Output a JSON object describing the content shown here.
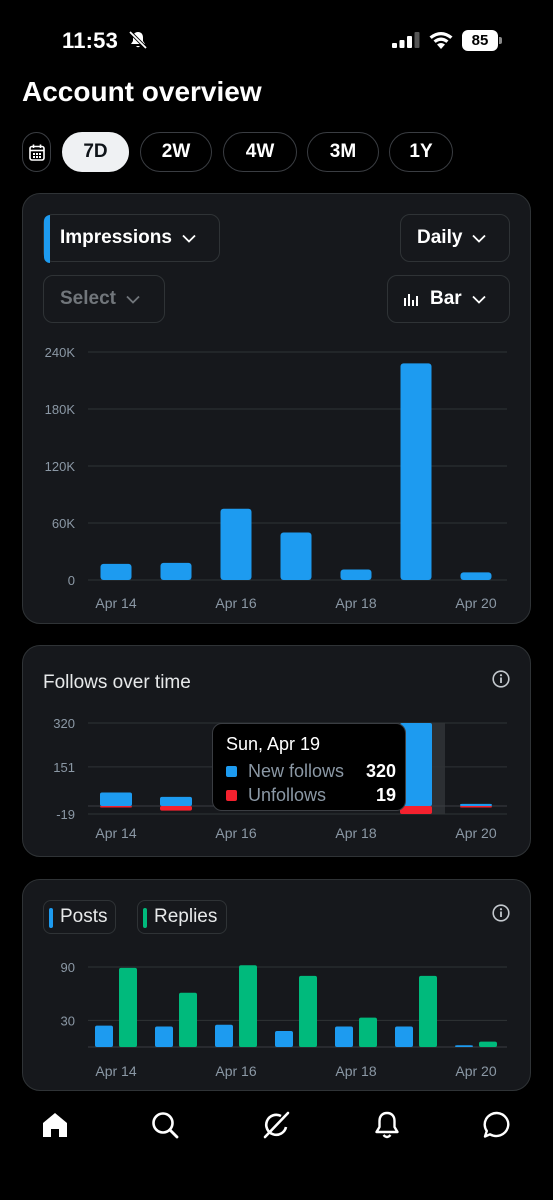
{
  "status_bar": {
    "time": "11:53",
    "battery": "85"
  },
  "page_title": "Account overview",
  "ranges": [
    {
      "label": "7D",
      "active": true
    },
    {
      "label": "2W",
      "active": false
    },
    {
      "label": "4W",
      "active": false
    },
    {
      "label": "3M",
      "active": false
    },
    {
      "label": "1Y",
      "active": false
    }
  ],
  "impressions_card": {
    "metric_select": "Impressions",
    "period_select": "Daily",
    "compare_select": "Select",
    "chart_type_select": "Bar"
  },
  "follows_card": {
    "title": "Follows over time",
    "tooltip": {
      "title": "Sun, Apr 19",
      "rows": [
        {
          "label": "New follows",
          "value": "320",
          "color": "#1d9bf0"
        },
        {
          "label": "Unfollows",
          "value": "19",
          "color": "#f4212e"
        }
      ]
    }
  },
  "posts_card": {
    "legend": [
      {
        "label": "Posts",
        "color": "#1d9bf0"
      },
      {
        "label": "Replies",
        "color": "#00ba7c"
      }
    ]
  },
  "bottom_nav": [
    "home-icon",
    "search-icon",
    "grok-icon",
    "notifications-icon",
    "messages-icon"
  ],
  "chart_data": [
    {
      "type": "bar",
      "categories": [
        "Apr 14",
        "Apr 15",
        "Apr 16",
        "Apr 17",
        "Apr 18",
        "Apr 19",
        "Apr 20"
      ],
      "x_tick_labels": [
        "Apr 14",
        "Apr 16",
        "Apr 18",
        "Apr 20"
      ],
      "series": [
        {
          "values": [
            17000,
            18000,
            75000,
            50000,
            11000,
            228000,
            8000
          ],
          "color": "#1d9bf0"
        }
      ],
      "y_ticks": [
        "240K",
        "180K",
        "120K",
        "60K",
        "0"
      ],
      "y_tick_values": [
        240000,
        180000,
        120000,
        60000,
        0
      ],
      "ylim": [
        0,
        240000
      ],
      "grid": true
    },
    {
      "type": "bar",
      "title": "Follows over time",
      "categories": [
        "Apr 14",
        "Apr 15",
        "Apr 16",
        "Apr 17",
        "Apr 18",
        "Apr 19",
        "Apr 20"
      ],
      "x_tick_labels": [
        "Apr 14",
        "Apr 16",
        "Apr 18",
        "Apr 20"
      ],
      "series": [
        {
          "name": "New follows",
          "values": [
            52,
            35,
            null,
            null,
            null,
            320,
            8
          ],
          "color": "#1d9bf0"
        },
        {
          "name": "Unfollows",
          "values": [
            -3,
            -11,
            null,
            null,
            null,
            -19,
            -1
          ],
          "color": "#f4212e"
        }
      ],
      "y_ticks": [
        "320",
        "151",
        "-19"
      ],
      "y_tick_values": [
        320,
        151,
        -19
      ],
      "ylim": [
        -19,
        320
      ],
      "grid": true,
      "highlight_category": "Apr 19"
    },
    {
      "type": "bar",
      "categories": [
        "Apr 14",
        "Apr 15",
        "Apr 16",
        "Apr 17",
        "Apr 18",
        "Apr 19",
        "Apr 20"
      ],
      "x_tick_labels": [
        "Apr 14",
        "Apr 16",
        "Apr 18",
        "Apr 20"
      ],
      "series": [
        {
          "name": "Posts",
          "values": [
            24,
            23,
            25,
            18,
            23,
            23,
            2
          ],
          "color": "#1d9bf0"
        },
        {
          "name": "Replies",
          "values": [
            89,
            61,
            92,
            80,
            33,
            80,
            6
          ],
          "color": "#00ba7c"
        }
      ],
      "y_ticks": [
        "90",
        "30"
      ],
      "y_tick_values": [
        90,
        30
      ],
      "grid": true
    }
  ]
}
